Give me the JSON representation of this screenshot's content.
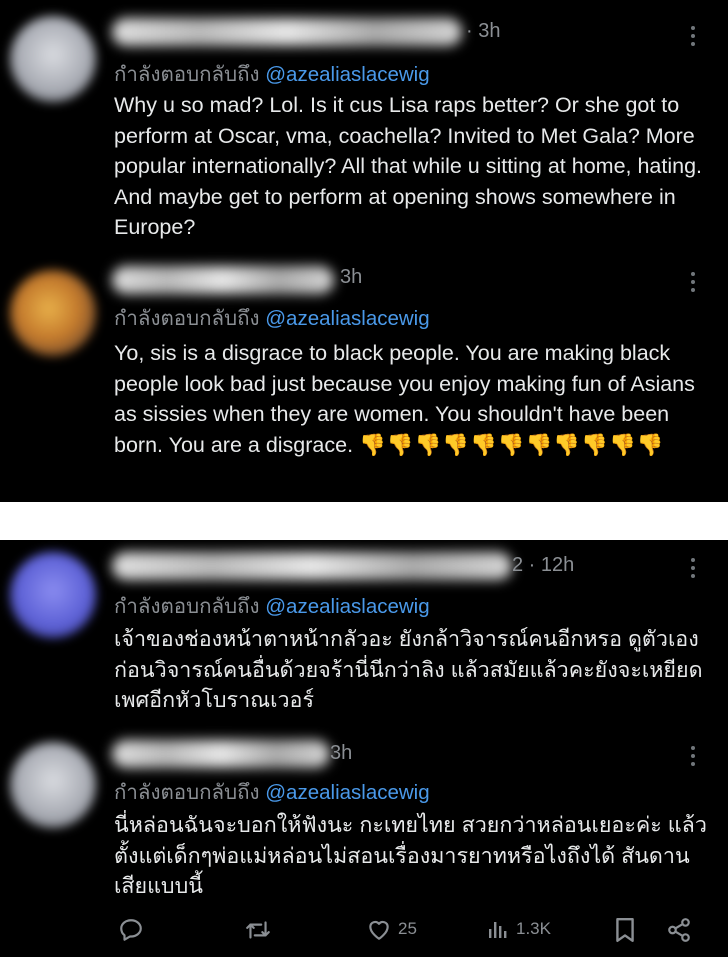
{
  "panel1": {
    "tweets": [
      {
        "time": "· 3h",
        "reply_prefix": "กำลังตอบกลับถึง",
        "handle": "@azealiaslacewig",
        "text": "Why u so mad? Lol. Is it cus Lisa raps better? Or she got to perform at Oscar, vma, coachella? Invited to Met Gala? More popular internationally? All that while u sitting at home, hating. And maybe get to perform at opening shows somewhere in Europe?"
      },
      {
        "time": "3h",
        "reply_prefix": "กำลังตอบกลับถึง",
        "handle": "@azealiaslacewig",
        "text": "Yo, sis is a disgrace to black people. You are making black people look bad just because you enjoy making fun of Asians as sissies when they are women. You shouldn't have been born. You are a disgrace.",
        "emoji": "👎👎👎👎👎👎👎👎👎👎👎"
      }
    ]
  },
  "panel2": {
    "tweets": [
      {
        "time": "2 · 12h",
        "reply_prefix": "กำลังตอบกลับถึง",
        "handle": "@azealiaslacewig",
        "text": "เจ้าของช่องหน้าตาหน้ากลัวอะ ยังกล้าวิจารณ์คนอีกหรอ ดูตัวเอง ก่อนวิจารณ์คนอื่นด้วยจร้านี่นีกว่าลิง แล้วสมัยแล้วคะยังจะเหยียด เพศอีกหัวโบราณเวอร์"
      },
      {
        "time": "3h",
        "reply_prefix": "กำลังตอบกลับถึง",
        "handle": "@azealiaslacewig",
        "text": "นี่หล่อนฉันจะบอกให้ฟังนะ กะเทยไทย สวยกว่าหล่อนเยอะค่ะ แล้วตั้งแต่เด็กๆพ่อแม่หล่อนไม่สอนเรื่องมารยาทหรือไงถึงได้ สันดานเสียแบบนี้"
      }
    ],
    "actions": {
      "likes": "25",
      "views": "1.3K"
    }
  },
  "icons": [
    "more-icon",
    "reply-icon",
    "retweet-icon",
    "like-icon",
    "views-icon",
    "bookmark-icon",
    "share-icon"
  ]
}
